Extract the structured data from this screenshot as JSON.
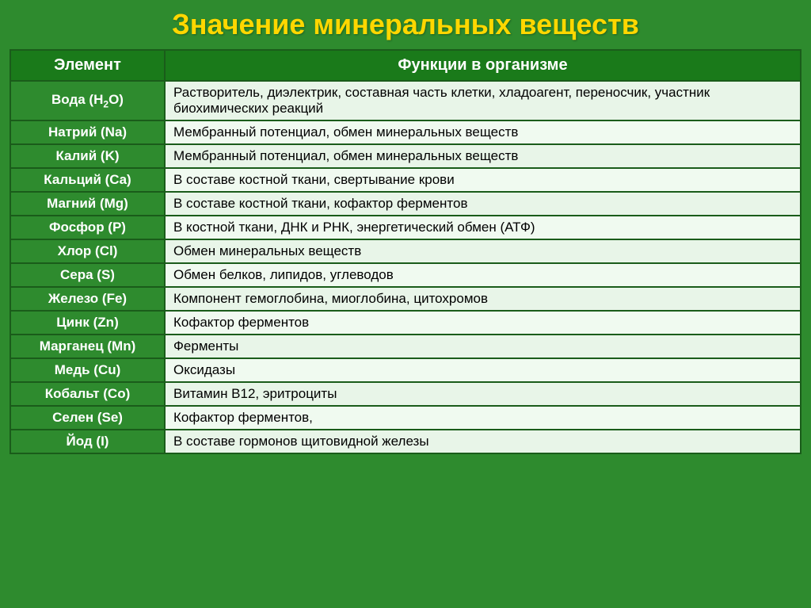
{
  "title": "Значение минеральных веществ",
  "table": {
    "col1_header": "Элемент",
    "col2_header": "Функции в организме",
    "rows": [
      {
        "element": "Вода (H₂O)",
        "element_html": "Вода (H<sub>2</sub>O)",
        "function": "Растворитель, диэлектрик, составная часть клетки, хладоагент, переносчик, участник биохимических реакций"
      },
      {
        "element": "Натрий (Na)",
        "function": "Мембранный потенциал, обмен минеральных веществ"
      },
      {
        "element": "Калий (K)",
        "function": "Мембранный потенциал, обмен минеральных веществ"
      },
      {
        "element": "Кальций (Ca)",
        "function": "В составе костной ткани, свертывание крови"
      },
      {
        "element": "Магний (Mg)",
        "function": "В составе костной ткани, кофактор ферментов"
      },
      {
        "element": "Фосфор (P)",
        "function": "В костной ткани,  ДНК и РНК, энергетический обмен  (АТФ)"
      },
      {
        "element": "Хлор (Cl)",
        "function": "Обмен минеральных веществ"
      },
      {
        "element": "Сера (S)",
        "function": "Обмен белков, липидов, углеводов"
      },
      {
        "element": "Железо (Fe)",
        "function": "Компонент гемоглобина, миоглобина, цитохромов"
      },
      {
        "element": "Цинк (Zn)",
        "function": "Кофактор ферментов"
      },
      {
        "element": "Марганец (Mn)",
        "function": "Ферменты"
      },
      {
        "element": "Медь (Cu)",
        "function": "Оксидазы"
      },
      {
        "element": "Кобальт (Co)",
        "function": "Витамин В12, эритроциты"
      },
      {
        "element": "Селен (Se)",
        "function": "Кофактор ферментов,"
      },
      {
        "element": "Йод (I)",
        "function": "В составе гормонов щитовидной железы"
      }
    ]
  }
}
